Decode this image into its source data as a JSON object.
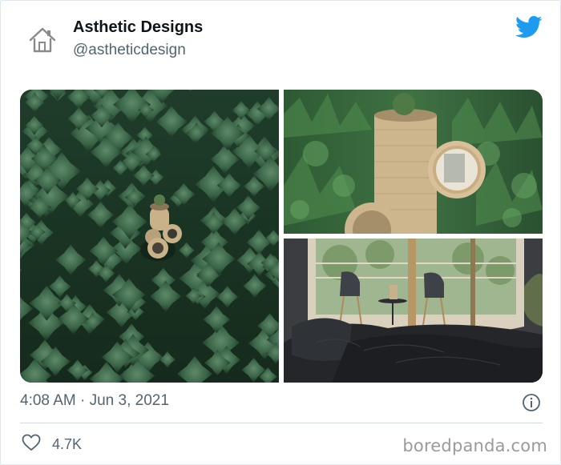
{
  "tweet": {
    "author_name": "Asthetic Designs",
    "author_handle": "@astheticdesign",
    "avatar_icon": "house-icon",
    "brand_icon": "twitter-bird-icon",
    "brand_color": "#1d9bf0",
    "timestamp": "4:08 AM · Jun 3, 2021",
    "likes_count": "4.7K",
    "like_icon": "heart-outline-icon",
    "info_icon": "info-circle-icon"
  },
  "media": {
    "photo_1": "forest-treehouse-aerial-photo",
    "photo_2": "treehouse-closeup-photo",
    "photo_3": "treehouse-bedroom-interior-photo"
  },
  "watermark": "boredpanda.com"
}
